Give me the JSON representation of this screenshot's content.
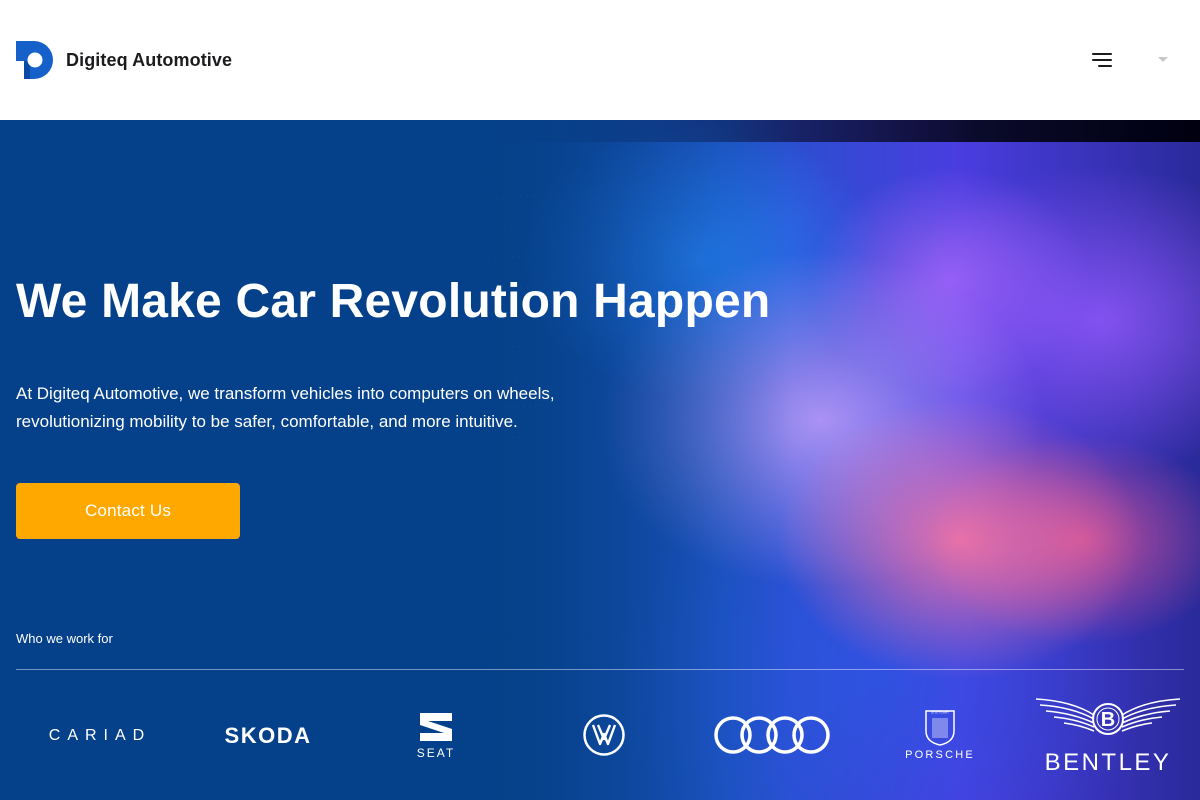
{
  "header": {
    "brand_name": "Digiteq Automotive",
    "logo_icon": "digiteq-d-logo",
    "menu_icon": "hamburger-menu-icon",
    "language_icon": "caret-down-icon"
  },
  "hero": {
    "title": "We Make Car Revolution Happen",
    "description": "At Digiteq Automotive, we transform vehicles into computers on wheels, revolutionizing mobility to be safer, comfortable, and more intuitive.",
    "cta_label": "Contact Us",
    "partners_label": "Who we work for",
    "partners": [
      {
        "name": "CARIAD",
        "icon": "cariad-logo"
      },
      {
        "name": "SKODA",
        "icon": "skoda-logo"
      },
      {
        "name": "SEAT",
        "icon": "seat-logo"
      },
      {
        "name": "Volkswagen",
        "icon": "vw-logo"
      },
      {
        "name": "Audi",
        "icon": "audi-rings-logo"
      },
      {
        "name": "PORSCHE",
        "icon": "porsche-crest-logo"
      },
      {
        "name": "BENTLEY",
        "icon": "bentley-wings-logo"
      }
    ]
  },
  "colors": {
    "primary_blue": "#08418c",
    "logo_blue": "#1561c9",
    "cta_orange": "#ffa800",
    "text_dark": "#1c1c1e"
  }
}
